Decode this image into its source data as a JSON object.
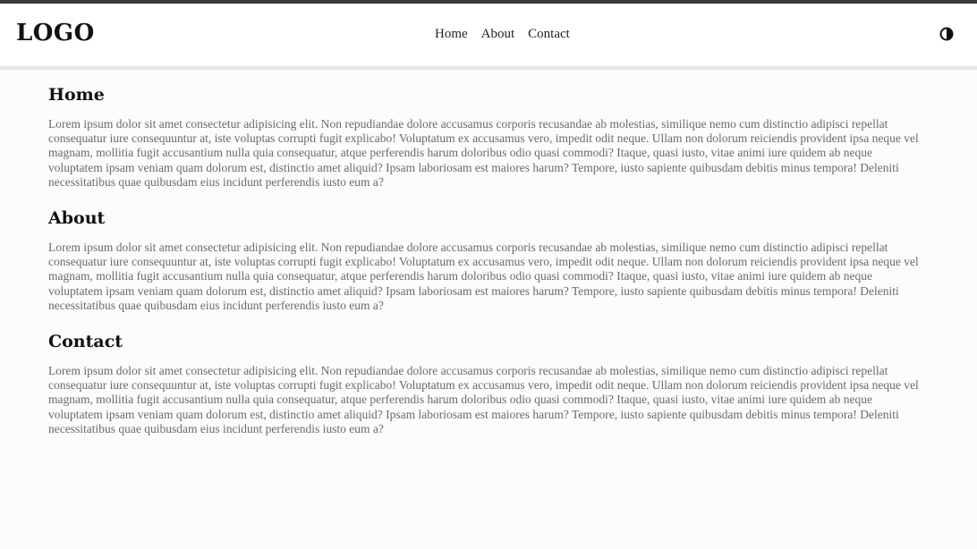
{
  "header": {
    "logo": "LOGO",
    "nav": [
      "Home",
      "About",
      "Contact"
    ],
    "theme_toggle_icon": "half-circle-contrast-icon"
  },
  "sections": [
    {
      "title": "Home",
      "body": "Lorem ipsum dolor sit amet consectetur adipisicing elit. Non repudiandae dolore accusamus corporis recusandae ab molestias, similique nemo cum distinctio adipisci repellat consequatur iure consequuntur at, iste voluptas corrupti fugit explicabo! Voluptatum ex accusamus vero, impedit odit neque. Ullam non dolorum reiciendis provident ipsa neque vel magnam, mollitia fugit accusantium nulla quia consequatur, atque perferendis harum doloribus odio quasi commodi? Itaque, quasi iusto, vitae animi iure quidem ab neque voluptatem ipsam veniam quam dolorum est, distinctio amet aliquid? Ipsam laboriosam est maiores harum? Tempore, iusto sapiente quibusdam debitis minus tempora! Deleniti necessitatibus quae quibusdam eius incidunt perferendis iusto eum a?"
    },
    {
      "title": "About",
      "body": "Lorem ipsum dolor sit amet consectetur adipisicing elit. Non repudiandae dolore accusamus corporis recusandae ab molestias, similique nemo cum distinctio adipisci repellat consequatur iure consequuntur at, iste voluptas corrupti fugit explicabo! Voluptatum ex accusamus vero, impedit odit neque. Ullam non dolorum reiciendis provident ipsa neque vel magnam, mollitia fugit accusantium nulla quia consequatur, atque perferendis harum doloribus odio quasi commodi? Itaque, quasi iusto, vitae animi iure quidem ab neque voluptatem ipsam veniam quam dolorum est, distinctio amet aliquid? Ipsam laboriosam est maiores harum? Tempore, iusto sapiente quibusdam debitis minus tempora! Deleniti necessitatibus quae quibusdam eius incidunt perferendis iusto eum a?"
    },
    {
      "title": "Contact",
      "body": "Lorem ipsum dolor sit amet consectetur adipisicing elit. Non repudiandae dolore accusamus corporis recusandae ab molestias, similique nemo cum distinctio adipisci repellat consequatur iure consequuntur at, iste voluptas corrupti fugit explicabo! Voluptatum ex accusamus vero, impedit odit neque. Ullam non dolorum reiciendis provident ipsa neque vel magnam, mollitia fugit accusantium nulla quia consequatur, atque perferendis harum doloribus odio quasi commodi? Itaque, quasi iusto, vitae animi iure quidem ab neque voluptatem ipsam veniam quam dolorum est, distinctio amet aliquid? Ipsam laboriosam est maiores harum? Tempore, iusto sapiente quibusdam debitis minus tempora! Deleniti necessitatibus quae quibusdam eius incidunt perferendis iusto eum a?"
    }
  ]
}
